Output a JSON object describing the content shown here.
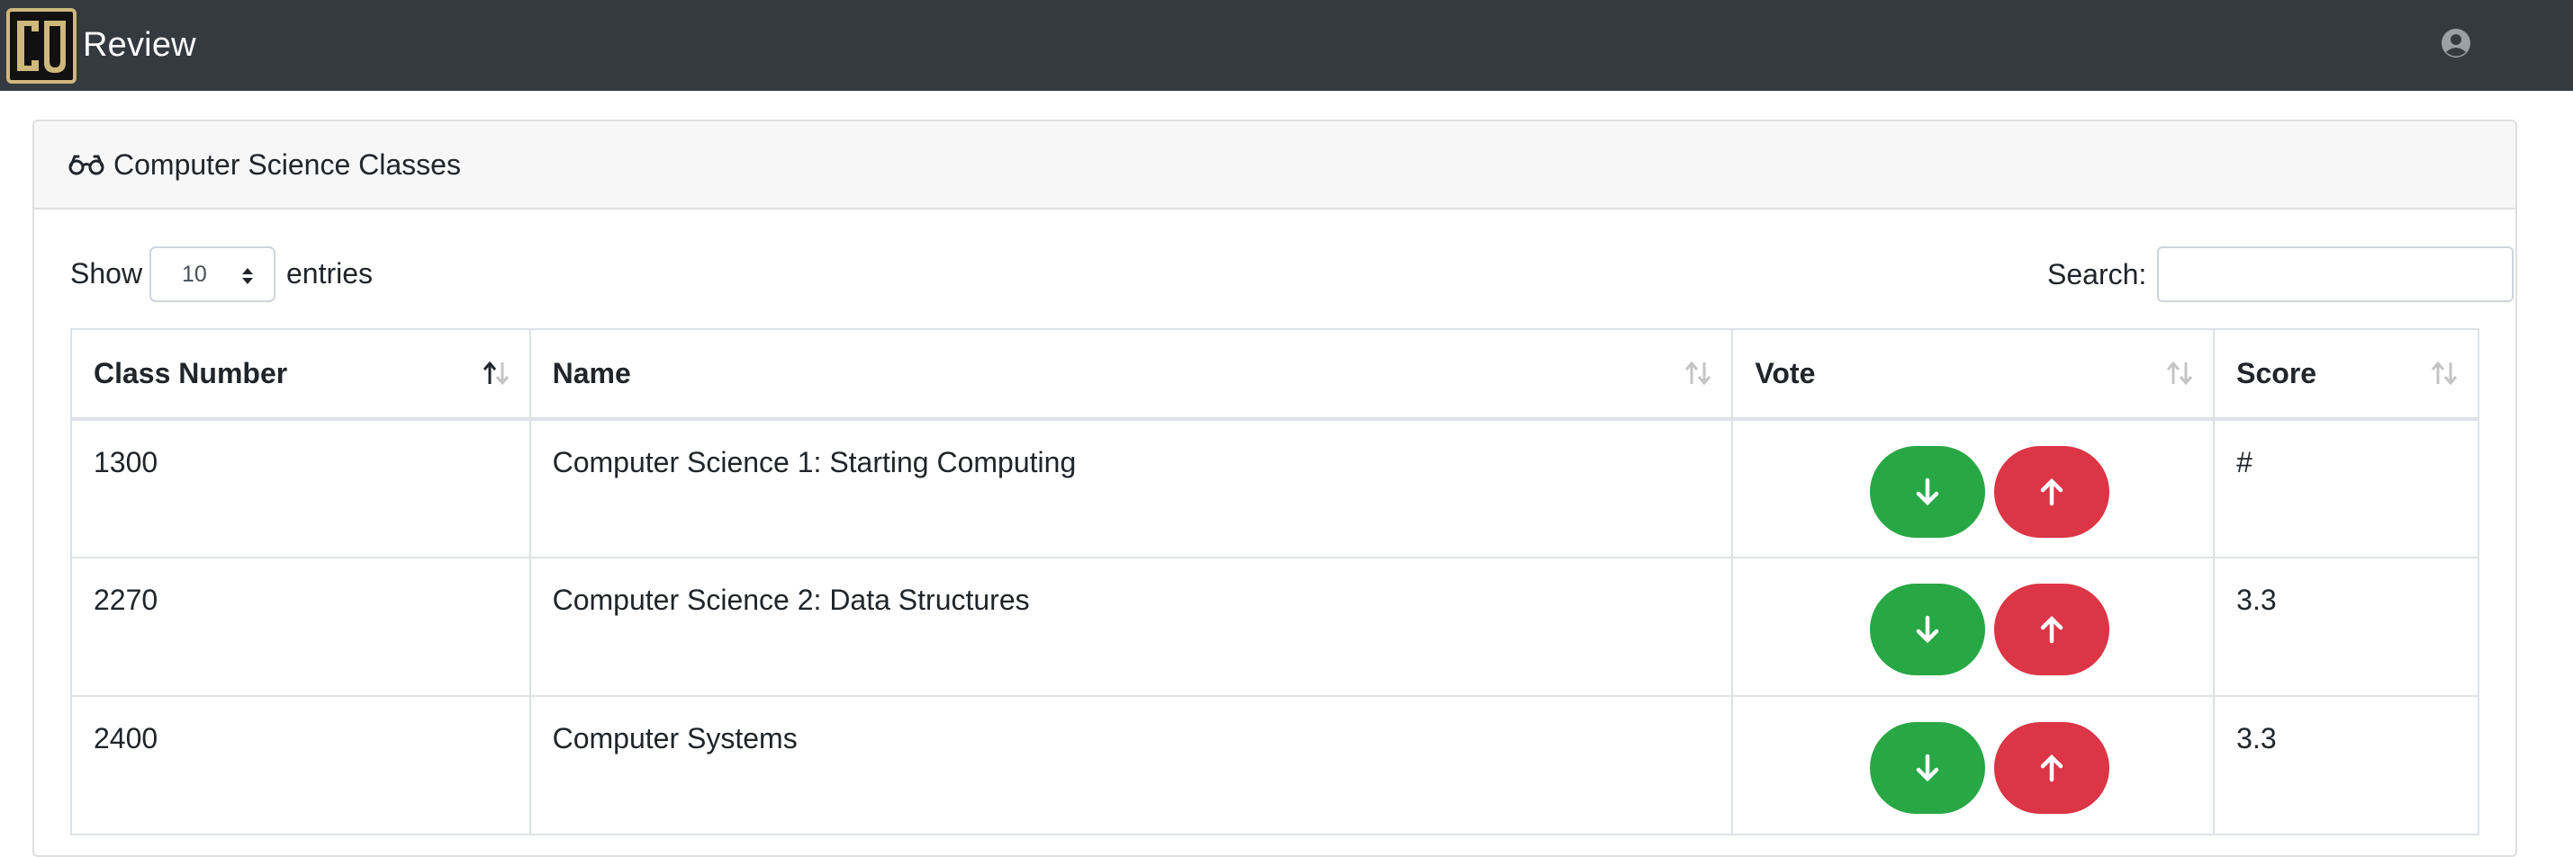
{
  "navbar": {
    "brand_logo_text": "CU",
    "brand_text": "Review",
    "background": "#343a40",
    "logo_gold": "#cfb87c",
    "user_icon": "user-circle-icon"
  },
  "card": {
    "title_icon": "glasses-icon",
    "title": "Computer Science Classes"
  },
  "controls": {
    "show_label": "Show",
    "length_value": "10",
    "entries_label": "entries",
    "search_label": "Search:",
    "search_value": ""
  },
  "table": {
    "columns": [
      {
        "label": "Class Number",
        "sort": "ascending"
      },
      {
        "label": "Name",
        "sort": "none"
      },
      {
        "label": "Vote",
        "sort": "none"
      },
      {
        "label": "Score",
        "sort": "none"
      }
    ],
    "rows": [
      {
        "number": "1300",
        "name": "Computer Science 1: Starting Computing",
        "score": "#"
      },
      {
        "number": "2270",
        "name": "Computer Science 2: Data Structures",
        "score": "3.3"
      },
      {
        "number": "2400",
        "name": "Computer Systems",
        "score": "3.3"
      }
    ],
    "vote_buttons": {
      "down_icon": "arrow-down-icon",
      "up_icon": "arrow-up-icon",
      "down_color": "#28a745",
      "up_color": "#dc3545"
    }
  }
}
